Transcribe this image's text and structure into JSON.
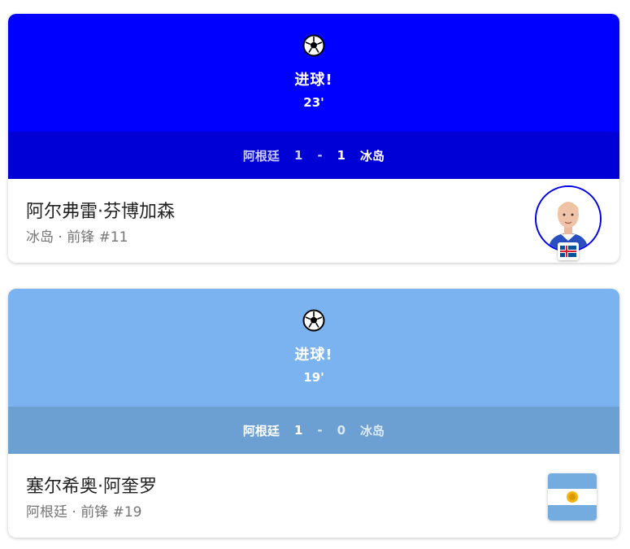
{
  "events": [
    {
      "title": "进球!",
      "minute": "23'",
      "home_team": "阿根廷",
      "home_score": "1",
      "separator": "-",
      "away_score": "1",
      "away_team": "冰岛",
      "player_name": "阿尔弗雷·芬博加森",
      "player_info": "冰岛 · 前锋 #11",
      "hero_color": "#0000ff",
      "bar_color": "#0000d6",
      "icon": "soccer-ball-icon",
      "player_badge": "iceland-flag-icon"
    },
    {
      "title": "进球!",
      "minute": "19'",
      "home_team": "阿根廷",
      "home_score": "1",
      "separator": "-",
      "away_score": "0",
      "away_team": "冰岛",
      "player_name": "塞尔希奥·阿奎罗",
      "player_info": "阿根廷 · 前锋 #19",
      "hero_color": "#7ab3f0",
      "bar_color": "#6c9fd2",
      "icon": "soccer-ball-icon",
      "player_badge": "argentina-flag-icon"
    }
  ]
}
